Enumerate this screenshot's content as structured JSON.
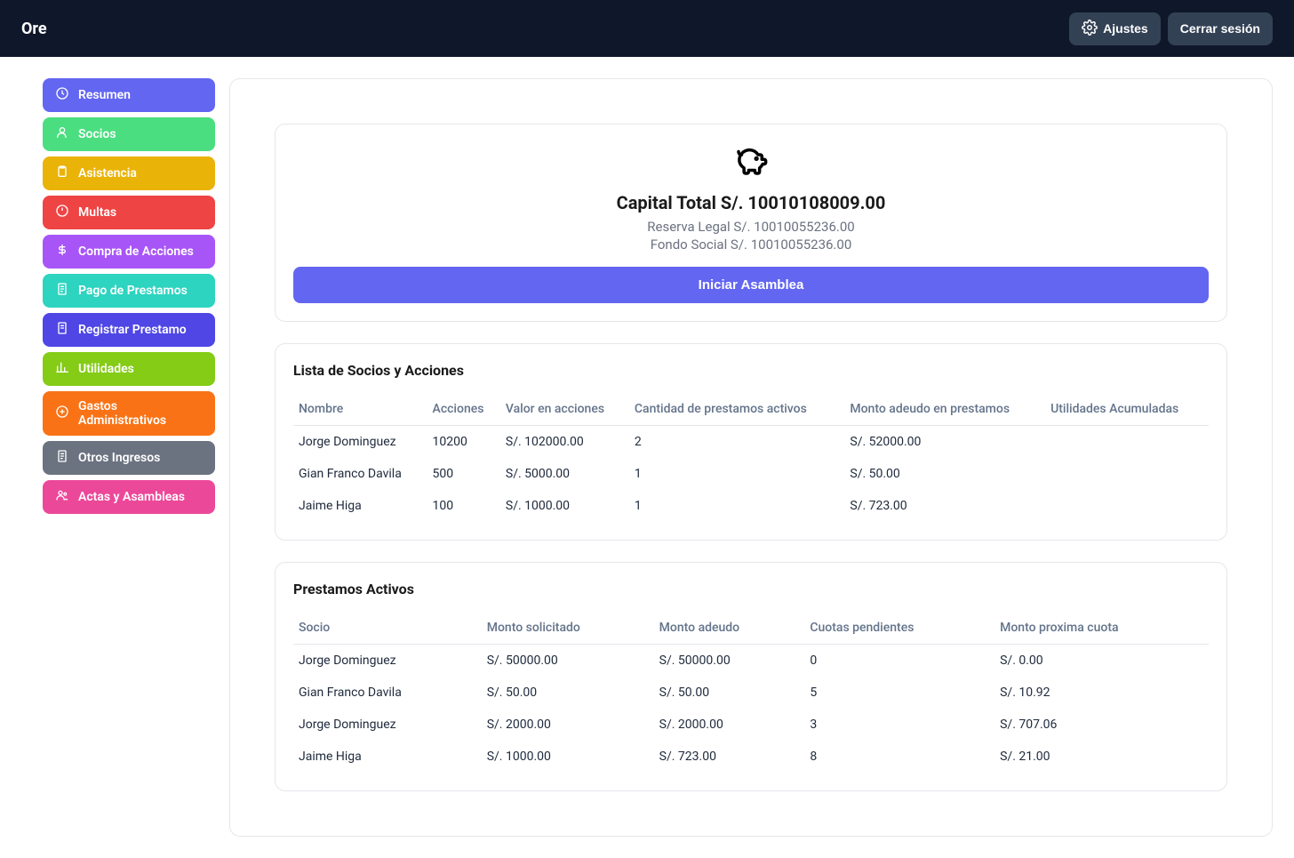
{
  "header": {
    "logo": "Ore",
    "settings_label": "Ajustes",
    "logout_label": "Cerrar sesión"
  },
  "sidebar": {
    "items": [
      {
        "label": "Resumen"
      },
      {
        "label": "Socios"
      },
      {
        "label": "Asistencia"
      },
      {
        "label": "Multas"
      },
      {
        "label": "Compra de Acciones"
      },
      {
        "label": "Pago de Prestamos"
      },
      {
        "label": "Registrar Prestamo"
      },
      {
        "label": "Utilidades"
      },
      {
        "label": "Gastos Administrativos"
      },
      {
        "label": "Otros Ingresos"
      },
      {
        "label": "Actas y Asambleas"
      }
    ]
  },
  "capital": {
    "title": "Capital Total S/. 10010108009.00",
    "reserva": "Reserva Legal S/. 10010055236.00",
    "fondo": "Fondo Social S/. 10010055236.00",
    "action": "Iniciar Asamblea"
  },
  "socios_section": {
    "title": "Lista de Socios y Acciones",
    "headers": {
      "nombre": "Nombre",
      "acciones": "Acciones",
      "valor": "Valor en acciones",
      "cantidad": "Cantidad de prestamos activos",
      "monto": "Monto adeudo en prestamos",
      "utilidades": "Utilidades Acumuladas"
    },
    "rows": [
      {
        "nombre": "Jorge Dominguez",
        "acciones": "10200",
        "valor": "S/. 102000.00",
        "cantidad": "2",
        "monto": "S/. 52000.00",
        "utilidades": ""
      },
      {
        "nombre": "Gian Franco Davila",
        "acciones": "500",
        "valor": "S/. 5000.00",
        "cantidad": "1",
        "monto": "S/. 50.00",
        "utilidades": ""
      },
      {
        "nombre": "Jaime Higa",
        "acciones": "100",
        "valor": "S/. 1000.00",
        "cantidad": "1",
        "monto": "S/. 723.00",
        "utilidades": ""
      }
    ]
  },
  "prestamos_section": {
    "title": "Prestamos Activos",
    "headers": {
      "socio": "Socio",
      "solicitado": "Monto solicitado",
      "adeudo": "Monto adeudo",
      "cuotas": "Cuotas pendientes",
      "proxima": "Monto proxima cuota"
    },
    "rows": [
      {
        "socio": "Jorge Dominguez",
        "solicitado": "S/. 50000.00",
        "adeudo": "S/. 50000.00",
        "cuotas": "0",
        "proxima": "S/. 0.00"
      },
      {
        "socio": "Gian Franco Davila",
        "solicitado": "S/. 50.00",
        "adeudo": "S/. 50.00",
        "cuotas": "5",
        "proxima": "S/. 10.92"
      },
      {
        "socio": "Jorge Dominguez",
        "solicitado": "S/. 2000.00",
        "adeudo": "S/. 2000.00",
        "cuotas": "3",
        "proxima": "S/. 707.06"
      },
      {
        "socio": "Jaime Higa",
        "solicitado": "S/. 1000.00",
        "adeudo": "S/. 723.00",
        "cuotas": "8",
        "proxima": "S/. 21.00"
      }
    ]
  }
}
